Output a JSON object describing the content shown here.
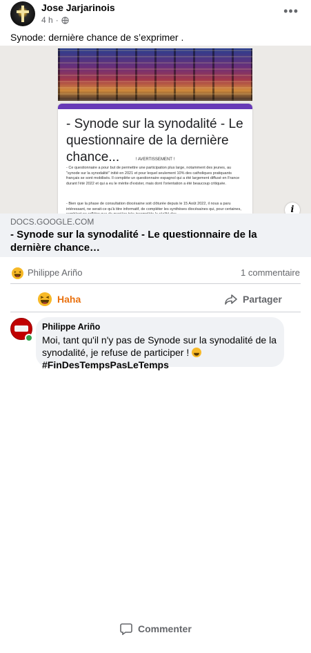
{
  "post": {
    "author": "Jose Jarjarinois",
    "time": "4 h",
    "visibility_icon": "globe-icon",
    "more_label": "•••",
    "text": "Synode: dernière chance de s’exprimer ."
  },
  "preview": {
    "doc_title": "- Synode sur la synodalité - Le questionnaire de la dernière chance...",
    "notice": "! AVERTISSEMENT !",
    "paragraph1": "- Ce questionnaire a pour but de permettre une participation plus large, notamment des jeunes, au \"synode sur la synodalité\" initié en 2021 et pour lequel seulement 10% des catholiques pratiquants français se sont mobilisés. Il complète un questionnaire espagnol qui a été largement diffusé en France durant l'été 2022 et qui a eu le mérite d'exister, mais dont l'orientation a été beaucoup critiquée.",
    "paragraph2": "- Bien que la phase de consultation diocésaine soit clôturée depuis le 15 Août 2022, il nous a paru intéressant, ne serait-ce qu'à titre informatif, de compléter les synthèses diocésaines qui, pour certaines, semblent ne refléter que de manière très incomplète la réalité des",
    "info_label": "i"
  },
  "link": {
    "domain": "DOCS.GOOGLE.COM",
    "title": "- Synode sur la synodalité - Le questionnaire de la dernière chance…"
  },
  "reactions": {
    "reactor": "Philippe Ariño",
    "comment_count": "1 commentaire"
  },
  "actions": {
    "haha": "Haha",
    "comment": "Commenter",
    "share": "Partager"
  },
  "comment": {
    "author": "Philippe Ariño",
    "text": "Moi, tant qu'il n'y pas de Synode sur la synodalité de la synodalité, je refuse de participer !",
    "hashtag": "#FinDesTempsPasLeTemps"
  },
  "colors": {
    "haha_active": "#e9710f",
    "form_accent": "#673ab7",
    "link_bg": "#f0f2f5"
  }
}
